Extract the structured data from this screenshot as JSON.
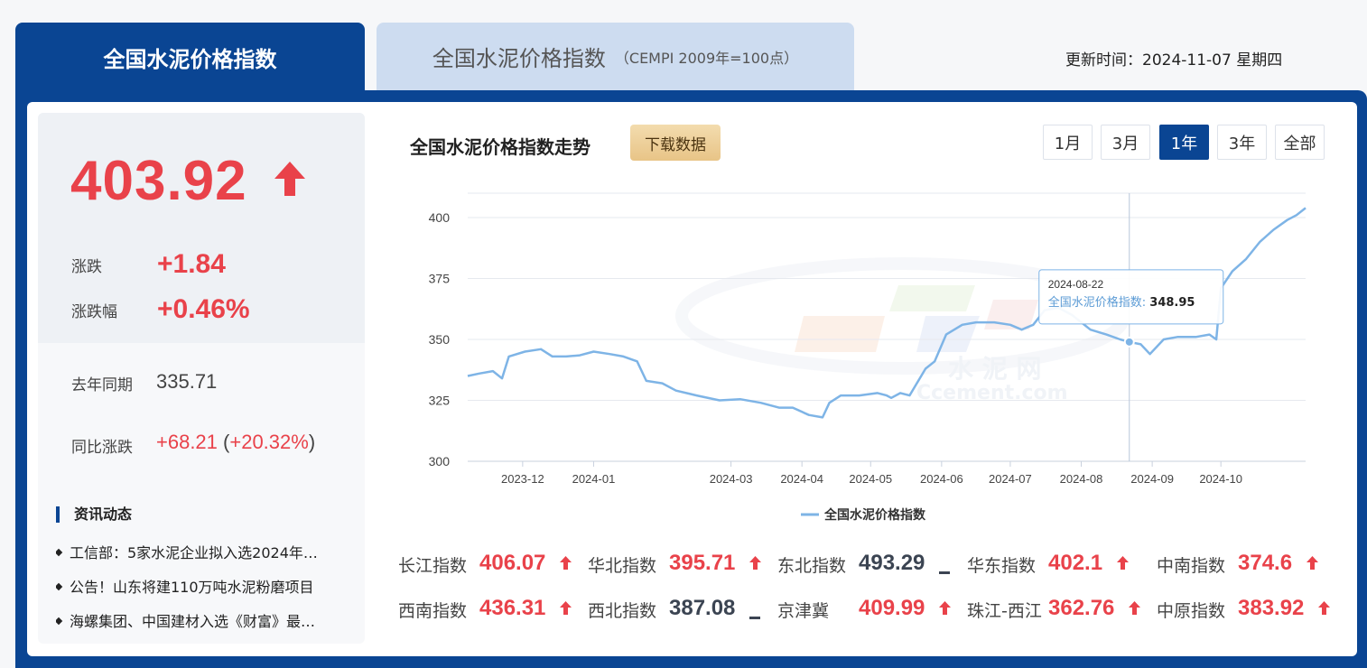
{
  "tabs": {
    "active": "全国水泥价格指数",
    "inactive_main": "全国水泥价格指数",
    "inactive_sub": "（CEMPI 2009年=100点）"
  },
  "update": {
    "text": "更新时间：2024-11-07 星期四"
  },
  "summary": {
    "value": "403.92",
    "change_label": "涨跌",
    "change": "+1.84",
    "change_pct_label": "涨跌幅",
    "change_pct": "+0.46%",
    "last_year_label": "去年同期",
    "last_year": "335.71",
    "yoy_label": "同比涨跌",
    "yoy": "+68.21",
    "yoy_open": " (",
    "yoy_pct": "+20.32%",
    "yoy_close": ")"
  },
  "news": {
    "title": "资讯动态",
    "items": [
      "工信部：5家水泥企业拟入选2024年…",
      "公告！山东将建110万吨水泥粉磨项目",
      "海螺集团、中国建材入选《财富》最…"
    ]
  },
  "chart_header": {
    "title": "全国水泥价格指数走势",
    "download": "下载数据"
  },
  "ranges": [
    {
      "label": "1月",
      "active": false
    },
    {
      "label": "3月",
      "active": false
    },
    {
      "label": "1年",
      "active": true
    },
    {
      "label": "3年",
      "active": false
    },
    {
      "label": "全部",
      "active": false
    }
  ],
  "chart_data": {
    "type": "line",
    "series": [
      {
        "name": "全国水泥价格指数",
        "color": "#7eb4e6",
        "points": [
          [
            "2023-11-07",
            335
          ],
          [
            "2023-11-12",
            336
          ],
          [
            "2023-11-18",
            337
          ],
          [
            "2023-11-22",
            334
          ],
          [
            "2023-11-25",
            343
          ],
          [
            "2023-12-02",
            345
          ],
          [
            "2023-12-09",
            346
          ],
          [
            "2023-12-14",
            343
          ],
          [
            "2023-12-20",
            343
          ],
          [
            "2023-12-26",
            343.5
          ],
          [
            "2024-01-01",
            345
          ],
          [
            "2024-01-08",
            344
          ],
          [
            "2024-01-14",
            343
          ],
          [
            "2024-01-20",
            341
          ],
          [
            "2024-01-24",
            333
          ],
          [
            "2024-01-31",
            332
          ],
          [
            "2024-02-06",
            329
          ],
          [
            "2024-02-15",
            327
          ],
          [
            "2024-02-25",
            325
          ],
          [
            "2024-03-05",
            325.5
          ],
          [
            "2024-03-14",
            324
          ],
          [
            "2024-03-22",
            322
          ],
          [
            "2024-03-28",
            322
          ],
          [
            "2024-04-04",
            319
          ],
          [
            "2024-04-10",
            318
          ],
          [
            "2024-04-13",
            324
          ],
          [
            "2024-04-18",
            327
          ],
          [
            "2024-04-26",
            327
          ],
          [
            "2024-05-04",
            328
          ],
          [
            "2024-05-08",
            327
          ],
          [
            "2024-05-10",
            326
          ],
          [
            "2024-05-14",
            328
          ],
          [
            "2024-05-18",
            327
          ],
          [
            "2024-05-25",
            338
          ],
          [
            "2024-05-29",
            341
          ],
          [
            "2024-06-03",
            352
          ],
          [
            "2024-06-10",
            356
          ],
          [
            "2024-06-16",
            357
          ],
          [
            "2024-06-24",
            357
          ],
          [
            "2024-07-01",
            356
          ],
          [
            "2024-07-06",
            354
          ],
          [
            "2024-07-11",
            356
          ],
          [
            "2024-07-16",
            362
          ],
          [
            "2024-07-22",
            363
          ],
          [
            "2024-07-28",
            360
          ],
          [
            "2024-08-05",
            354
          ],
          [
            "2024-08-12",
            352
          ],
          [
            "2024-08-18",
            350
          ],
          [
            "2024-08-22",
            348.95
          ],
          [
            "2024-08-27",
            348
          ],
          [
            "2024-08-31",
            344
          ],
          [
            "2024-09-06",
            350
          ],
          [
            "2024-09-12",
            351
          ],
          [
            "2024-09-20",
            351
          ],
          [
            "2024-09-26",
            352
          ],
          [
            "2024-09-29",
            350
          ],
          [
            "2024-10-01",
            371
          ],
          [
            "2024-10-06",
            378
          ],
          [
            "2024-10-12",
            383
          ],
          [
            "2024-10-18",
            390
          ],
          [
            "2024-10-24",
            395
          ],
          [
            "2024-10-30",
            399
          ],
          [
            "2024-11-03",
            401
          ],
          [
            "2024-11-07",
            403.92
          ]
        ]
      }
    ],
    "xlim": [
      "2023-11-07",
      "2024-11-07"
    ],
    "ylim": [
      300,
      410
    ],
    "yticks": [
      300,
      325,
      350,
      375,
      400
    ],
    "xticks": [
      "2023-12",
      "2024-01",
      "2024-03",
      "2024-04",
      "2024-05",
      "2024-06",
      "2024-07",
      "2024-08",
      "2024-09",
      "2024-10"
    ],
    "xtick_dates": [
      "2023-12-01",
      "2024-01-01",
      "2024-03-01",
      "2024-04-01",
      "2024-05-01",
      "2024-06-01",
      "2024-07-01",
      "2024-08-01",
      "2024-09-01",
      "2024-10-01"
    ],
    "grid": true,
    "legend": "bottom",
    "tooltip": {
      "date": "2024-08-22",
      "label": "全国水泥价格指数",
      "value": "348.95"
    },
    "watermark": {
      "cn": "水 泥 网",
      "en": "Ccement.com"
    }
  },
  "indices": [
    {
      "name": "长江指数",
      "value": "406.07",
      "dir": "up"
    },
    {
      "name": "华北指数",
      "value": "395.71",
      "dir": "up"
    },
    {
      "name": "东北指数",
      "value": "493.29",
      "dir": "flat"
    },
    {
      "name": "华东指数",
      "value": "402.1",
      "dir": "up"
    },
    {
      "name": "中南指数",
      "value": "374.6",
      "dir": "up"
    },
    {
      "name": "西南指数",
      "value": "436.31",
      "dir": "up"
    },
    {
      "name": "西北指数",
      "value": "387.08",
      "dir": "flat"
    },
    {
      "name": "京津冀",
      "value": "409.99",
      "dir": "up"
    },
    {
      "name": "珠江-西江",
      "value": "362.76",
      "dir": "up"
    },
    {
      "name": "中原指数",
      "value": "383.92",
      "dir": "up"
    }
  ],
  "colors": {
    "brand": "#0a4593",
    "up": "#e9424a",
    "flat": "#3b4452",
    "line": "#7eb4e6"
  }
}
